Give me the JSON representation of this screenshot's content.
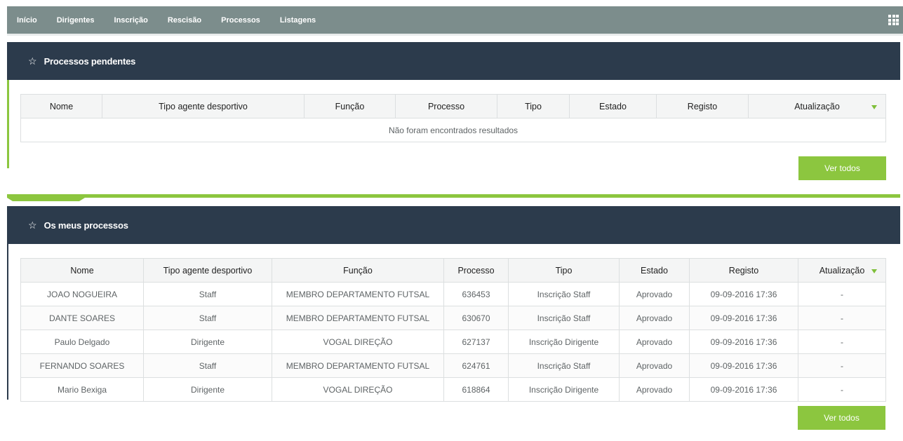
{
  "nav": {
    "items": [
      "Início",
      "Dirigentes",
      "Inscrição",
      "Rescisão",
      "Processos",
      "Listagens"
    ],
    "apps_icon": "grid-icon"
  },
  "pending": {
    "title": "Processos pendentes",
    "star_icon": "☆",
    "columns": [
      "Nome",
      "Tipo agente desportivo",
      "Função",
      "Processo",
      "Tipo",
      "Estado",
      "Registo",
      "Atualização"
    ],
    "empty_message": "Não foram encontrados resultados",
    "button_label": "Ver todos"
  },
  "mine": {
    "title": "Os meus processos",
    "star_icon": "☆",
    "columns": [
      "Nome",
      "Tipo agente desportivo",
      "Função",
      "Processo",
      "Tipo",
      "Estado",
      "Registo",
      "Atualização"
    ],
    "rows": [
      [
        "JOAO NOGUEIRA",
        "Staff",
        "MEMBRO DEPARTAMENTO FUTSAL",
        "636453",
        "Inscrição Staff",
        "Aprovado",
        "09-09-2016 17:36",
        "-"
      ],
      [
        "DANTE SOARES",
        "Staff",
        "MEMBRO DEPARTAMENTO FUTSAL",
        "630670",
        "Inscrição Staff",
        "Aprovado",
        "09-09-2016 17:36",
        "-"
      ],
      [
        "Paulo Delgado",
        "Dirigente",
        "VOGAL DIREÇÃO",
        "627137",
        "Inscrição Dirigente",
        "Aprovado",
        "09-09-2016 17:36",
        "-"
      ],
      [
        "FERNANDO SOARES",
        "Staff",
        "MEMBRO DEPARTAMENTO FUTSAL",
        "624761",
        "Inscrição Staff",
        "Aprovado",
        "09-09-2016 17:36",
        "-"
      ],
      [
        "Mario Bexiga",
        "Dirigente",
        "VOGAL DIREÇÃO",
        "618864",
        "Inscrição Dirigente",
        "Aprovado",
        "09-09-2016 17:36",
        "-"
      ]
    ],
    "button_label": "Ver todos"
  },
  "colors": {
    "nav_bg": "#7c8d8c",
    "header_bg": "#2c3b4c",
    "accent_green": "#8cc63f"
  }
}
